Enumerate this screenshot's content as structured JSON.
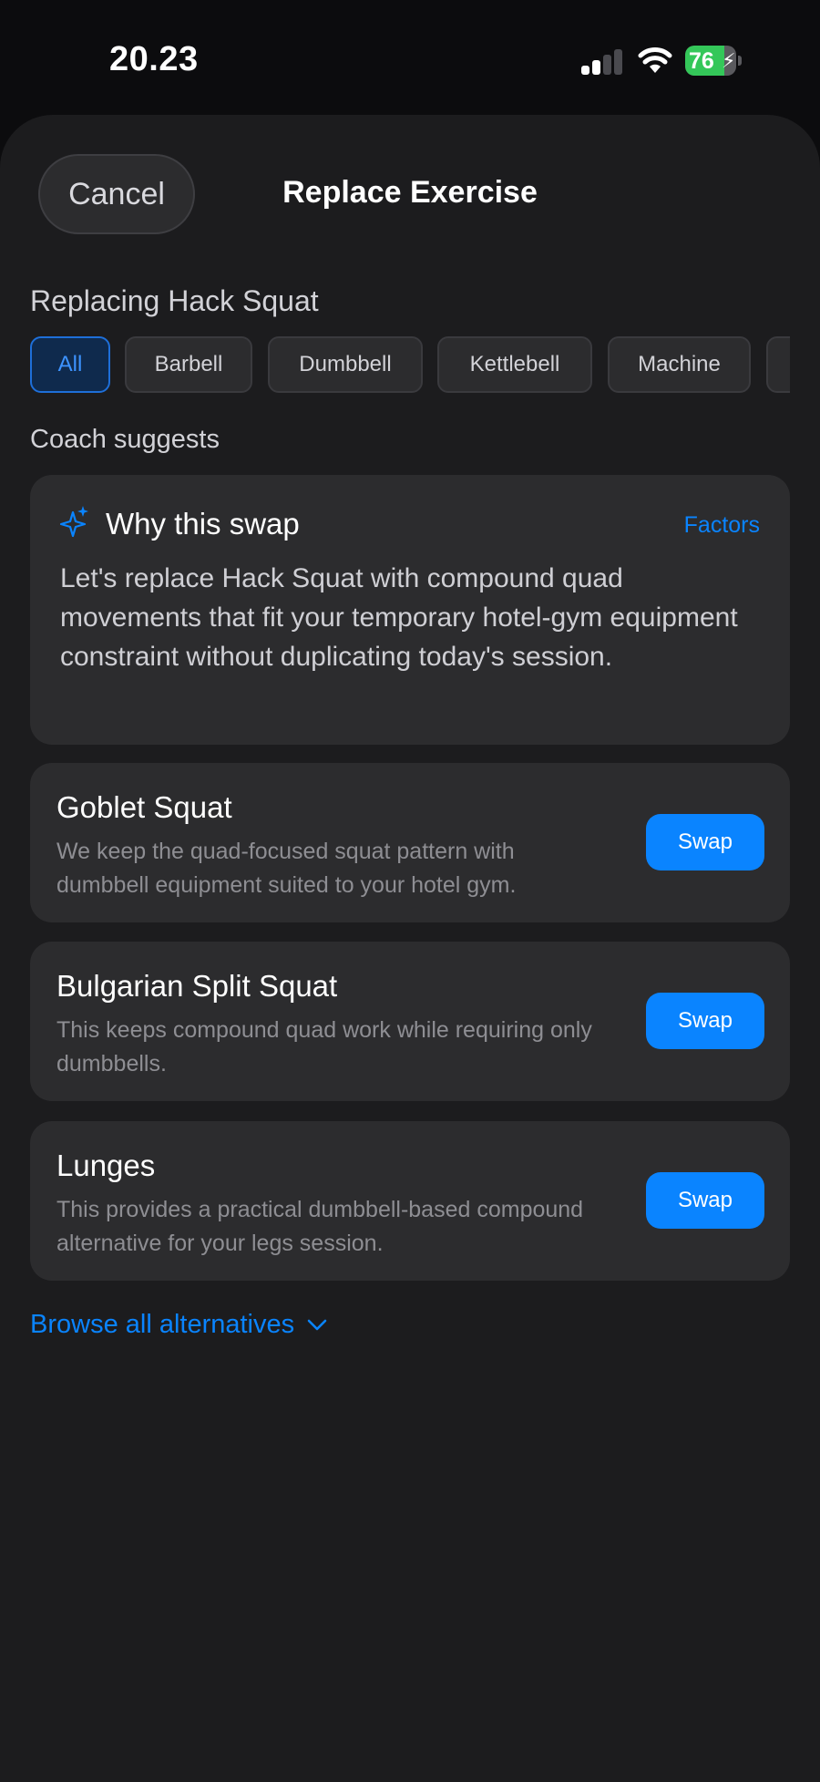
{
  "status_bar": {
    "time": "20.23",
    "battery_percent": "76",
    "battery_level": 0.76,
    "signal_bars_active": 2,
    "signal_bars_total": 4
  },
  "header": {
    "cancel_label": "Cancel",
    "title": "Replace Exercise"
  },
  "replacing_label": "Replacing Hack Squat",
  "filters": {
    "selected": "All",
    "chips": [
      "All",
      "Barbell",
      "Dumbbell",
      "Kettlebell",
      "Machine"
    ]
  },
  "coach": {
    "section_label": "Coach suggests",
    "card_title": "Why this swap",
    "factors_label": "Factors",
    "body": "Let's replace Hack Squat with compound quad movements that fit your temporary hotel-gym equipment constraint without duplicating today's session."
  },
  "alternatives": [
    {
      "name": "Goblet Squat",
      "description": "We keep the quad-focused squat pattern with dumbbell equipment suited to your hotel gym.",
      "action": "Swap"
    },
    {
      "name": "Bulgarian Split Squat",
      "description": "This keeps compound quad work while requiring only dumbbells.",
      "action": "Swap"
    },
    {
      "name": "Lunges",
      "description": "This provides a practical dumbbell-based compound alternative for your legs session.",
      "action": "Swap"
    }
  ],
  "browse_all_label": "Browse all alternatives",
  "colors": {
    "accent": "#0a84ff",
    "battery": "#34c759",
    "card": "#2c2c2e",
    "sheet": "#1c1c1e"
  }
}
